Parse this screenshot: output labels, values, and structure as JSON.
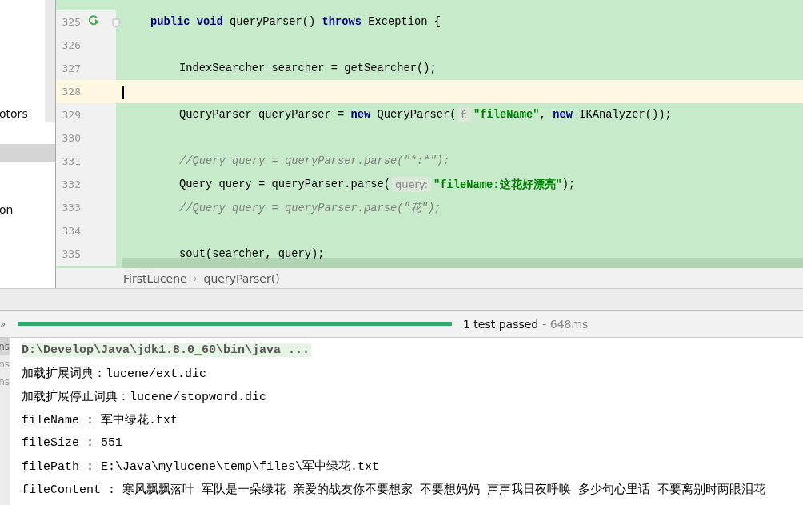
{
  "project_tree": {
    "items": [
      {
        "label": "otors",
        "selected": false
      },
      {
        "selected": true
      },
      {
        "label": "on",
        "selected": false
      }
    ]
  },
  "editor": {
    "lines": [
      {
        "number": "325",
        "current": false,
        "kind": "signature",
        "runnable": true,
        "foldable": true,
        "tokens": [
          {
            "kind": "keyword",
            "text": "public void"
          },
          {
            "kind": "plain",
            "text": " queryParser() "
          },
          {
            "kind": "keyword",
            "text": "throws"
          },
          {
            "kind": "plain",
            "text": " Exception {"
          }
        ]
      },
      {
        "number": "326",
        "current": false,
        "kind": "body"
      },
      {
        "number": "327",
        "current": false,
        "kind": "body",
        "tokens": [
          {
            "kind": "plain",
            "text": "IndexSearcher searcher = getSearcher();"
          }
        ]
      },
      {
        "number": "328",
        "current": true,
        "kind": "body"
      },
      {
        "number": "329",
        "current": false,
        "kind": "body",
        "tokens": [
          {
            "kind": "plain",
            "text": "QueryParser queryParser = "
          },
          {
            "kind": "keyword",
            "text": "new"
          },
          {
            "kind": "plain",
            "text": " QueryParser("
          },
          {
            "kind": "hint",
            "text": "f:"
          },
          {
            "kind": "string",
            "text": "\"fileName\""
          },
          {
            "kind": "plain",
            "text": ", "
          },
          {
            "kind": "keyword",
            "text": "new"
          },
          {
            "kind": "plain",
            "text": " IKAnalyzer());"
          }
        ]
      },
      {
        "number": "330",
        "current": false,
        "kind": "body"
      },
      {
        "number": "331",
        "current": false,
        "kind": "body",
        "tokens": [
          {
            "kind": "comment",
            "text": "//Query query = queryParser.parse(\"*:*\");"
          }
        ]
      },
      {
        "number": "332",
        "current": false,
        "kind": "body",
        "tokens": [
          {
            "kind": "plain",
            "text": "Query query = queryParser.parse("
          },
          {
            "kind": "hint",
            "text": "query:"
          },
          {
            "kind": "string",
            "text": "\"fileName:这花好漂亮\""
          },
          {
            "kind": "plain",
            "text": ");"
          }
        ]
      },
      {
        "number": "333",
        "current": false,
        "kind": "body",
        "tokens": [
          {
            "kind": "comment",
            "text": "//Query query = queryParser.parse(\"花\");"
          }
        ]
      },
      {
        "number": "334",
        "current": false,
        "kind": "body"
      },
      {
        "number": "335",
        "current": false,
        "kind": "body",
        "tokens": [
          {
            "kind": "plain",
            "text": "sout(searcher, query);"
          }
        ]
      }
    ]
  },
  "breadcrumbs": [
    "FirstLucene",
    "queryParser()"
  ],
  "breadcrumb_separator": "›",
  "test_bar": {
    "expand": "»",
    "level": 1.0,
    "status": "1 test passed",
    "duration": "- 648ms"
  },
  "console": {
    "side_items": [
      {
        "label": "ns",
        "selected": true
      },
      {
        "label": "ns",
        "selected": false
      },
      {
        "label": "ns",
        "selected": false
      }
    ],
    "lines": [
      {
        "kind": "command",
        "text": "D:\\Develop\\Java\\jdk1.8.0_60\\bin\\java ..."
      },
      {
        "kind": "output",
        "text": "加载扩展词典：lucene/ext.dic"
      },
      {
        "kind": "output",
        "text": "加载扩展停止词典：lucene/stopword.dic"
      },
      {
        "kind": "output",
        "text": "fileName : 军中绿花.txt"
      },
      {
        "kind": "output",
        "text": "fileSize : 551"
      },
      {
        "kind": "output",
        "text": "filePath : E:\\Java\\mylucene\\temp\\files\\军中绿花.txt"
      },
      {
        "kind": "output",
        "text": "fileContent : 寒风飘飘落叶 军队是一朵绿花 亲爱的战友你不要想家 不要想妈妈 声声我日夜呼唤 多少句心里话 不要离别时两眼泪花"
      }
    ]
  }
}
